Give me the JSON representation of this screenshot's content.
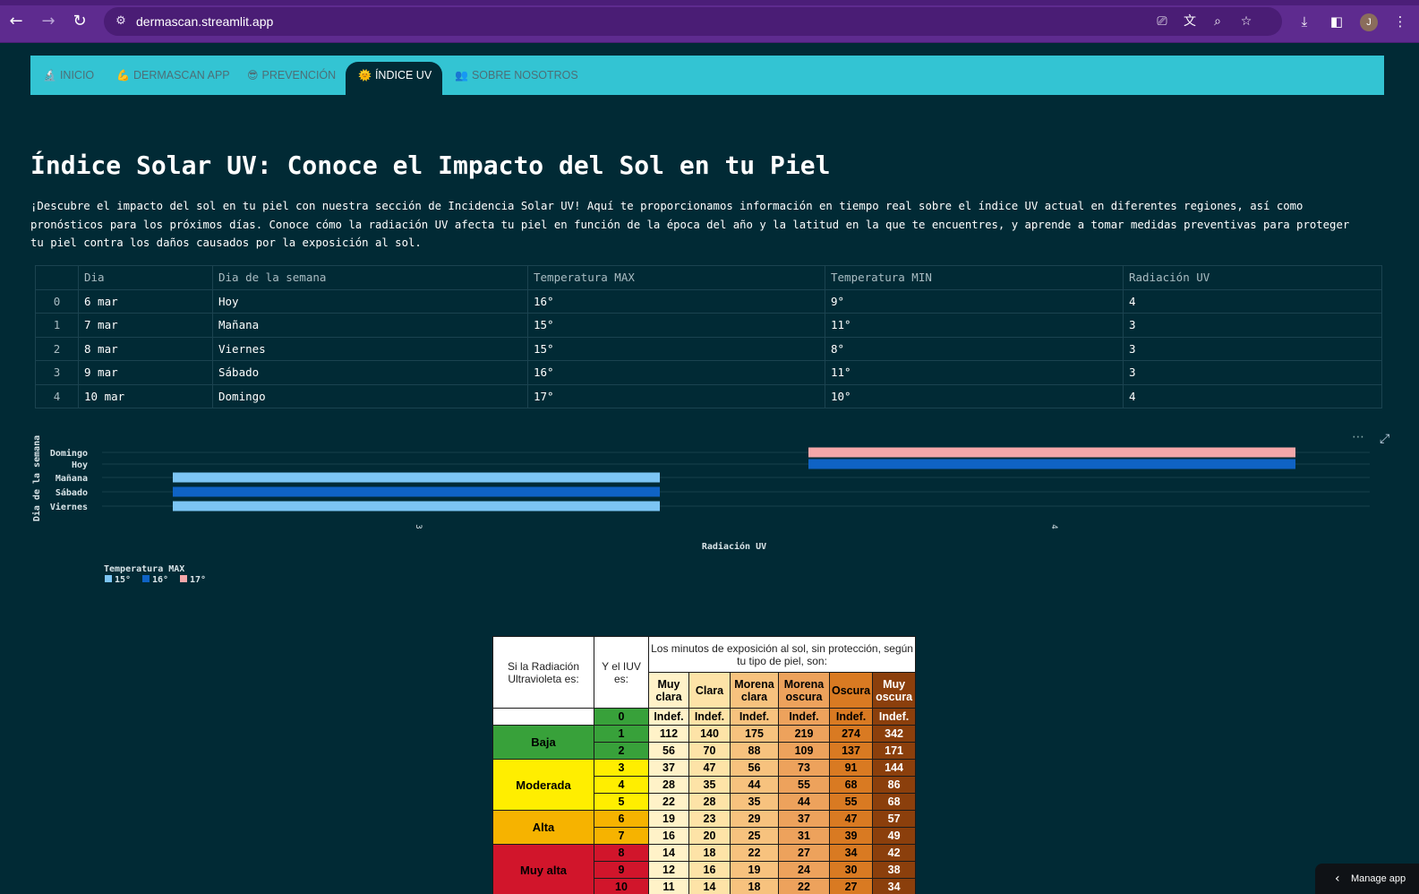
{
  "browser": {
    "url": "dermascan.streamlit.app",
    "back_icon": "arrow-left-icon",
    "forward_icon": "arrow-right-icon",
    "reload_icon": "reload-icon",
    "profile_initial": "J"
  },
  "nav": {
    "items": [
      {
        "label": "INICIO",
        "icon": "🔬",
        "active": false
      },
      {
        "label": "DERMASCAN APP",
        "icon": "💪",
        "active": false
      },
      {
        "label": "PREVENCIÓN",
        "icon": "😎",
        "active": false
      },
      {
        "label": "ÍNDICE UV",
        "icon": "🌞",
        "active": true
      },
      {
        "label": "SOBRE NOSOTROS",
        "icon": "👥",
        "active": false
      }
    ]
  },
  "page": {
    "title": "Índice Solar UV: Conoce el Impacto del Sol en tu Piel",
    "intro": "¡Descubre el impacto del sol en tu piel con nuestra sección de Incidencia Solar UV! Aquí te proporcionamos información en tiempo real sobre el índice UV actual en diferentes regiones, así como pronósticos para los próximos días. Conoce cómo la radiación UV afecta tu piel en función de la época del año y la latitud en la que te encuentres, y aprende a tomar medidas preventivas para proteger tu piel contra los daños causados por la exposición al sol."
  },
  "forecast_table": {
    "columns": [
      "",
      "Dia",
      "Dia de la semana",
      "Temperatura MAX",
      "Temperatura MIN",
      "Radiación UV"
    ],
    "rows": [
      [
        "0",
        "6 mar",
        "Hoy",
        "16°",
        "9°",
        "4"
      ],
      [
        "1",
        "7 mar",
        "Mañana",
        "15°",
        "11°",
        "3"
      ],
      [
        "2",
        "8 mar",
        "Viernes",
        "15°",
        "8°",
        "3"
      ],
      [
        "3",
        "9 mar",
        "Sábado",
        "16°",
        "11°",
        "3"
      ],
      [
        "4",
        "10 mar",
        "Domingo",
        "17°",
        "10°",
        "4"
      ]
    ]
  },
  "chart_data": {
    "type": "bar",
    "orientation": "horizontal",
    "categories": [
      "Domingo",
      "Hoy",
      "Mañana",
      "Sábado",
      "Viernes"
    ],
    "xlabel": "Radiación UV",
    "ylabel": "Dia de la semana",
    "x_ticks": [
      "3",
      "4"
    ],
    "legend_title": "Temperatura MAX",
    "legend_position": "bottom-left",
    "series": [
      {
        "name": "15°",
        "color": "#7cc5f4"
      },
      {
        "name": "16°",
        "color": "#0f63c5"
      },
      {
        "name": "17°",
        "color": "#f4a7a9"
      }
    ],
    "bars": [
      {
        "category": "Domingo",
        "value": 4,
        "series": "17°"
      },
      {
        "category": "Hoy",
        "value": 4,
        "series": "16°"
      },
      {
        "category": "Mañana",
        "value": 3,
        "series": "15°"
      },
      {
        "category": "Sábado",
        "value": 3,
        "series": "16°"
      },
      {
        "category": "Viernes",
        "value": 3,
        "series": "15°"
      }
    ],
    "menu_icon": "ellipsis-icon",
    "expand_icon": "expand-icon"
  },
  "uv_table": {
    "header_col1": "Si la Radiación Ultravioleta es:",
    "header_col2": "Y el IUV es:",
    "header_span": "Los minutos de exposición al sol, sin protección, según tu tipo de piel, son:",
    "skin_types": [
      "Muy clara",
      "Clara",
      "Morena clara",
      "Morena oscura",
      "Oscura",
      "Muy oscura"
    ],
    "skin_colors": [
      "#fff2c8",
      "#fde3a7",
      "#f7c27e",
      "#eda25c",
      "#d97a22",
      "#8b3f0c"
    ],
    "levels": [
      {
        "name": "",
        "color": "#ffffff",
        "rows": [
          [
            "0",
            "Indef.",
            "Indef.",
            "Indef.",
            "Indef.",
            "Indef.",
            "Indef."
          ]
        ],
        "iuv_color": "#38a13a"
      },
      {
        "name": "Baja",
        "color": "#38a13a",
        "iuv_color": "#38a13a",
        "rows": [
          [
            "1",
            "112",
            "140",
            "175",
            "219",
            "274",
            "342"
          ],
          [
            "2",
            "56",
            "70",
            "88",
            "109",
            "137",
            "171"
          ]
        ]
      },
      {
        "name": "Moderada",
        "color": "#ffee00",
        "iuv_color": "#ffee00",
        "rows": [
          [
            "3",
            "37",
            "47",
            "56",
            "73",
            "91",
            "144"
          ],
          [
            "4",
            "28",
            "35",
            "44",
            "55",
            "68",
            "86"
          ],
          [
            "5",
            "22",
            "28",
            "35",
            "44",
            "55",
            "68"
          ]
        ]
      },
      {
        "name": "Alta",
        "color": "#f6b300",
        "iuv_color": "#f6b300",
        "rows": [
          [
            "6",
            "19",
            "23",
            "29",
            "37",
            "47",
            "57"
          ],
          [
            "7",
            "16",
            "20",
            "25",
            "31",
            "39",
            "49"
          ]
        ]
      },
      {
        "name": "Muy alta",
        "color": "#d1152b",
        "iuv_color": "#d1152b",
        "rows": [
          [
            "8",
            "14",
            "18",
            "22",
            "27",
            "34",
            "42"
          ],
          [
            "9",
            "12",
            "16",
            "19",
            "24",
            "30",
            "38"
          ],
          [
            "10",
            "11",
            "14",
            "18",
            "22",
            "27",
            "34"
          ]
        ]
      }
    ]
  },
  "manage_app": "Manage app"
}
